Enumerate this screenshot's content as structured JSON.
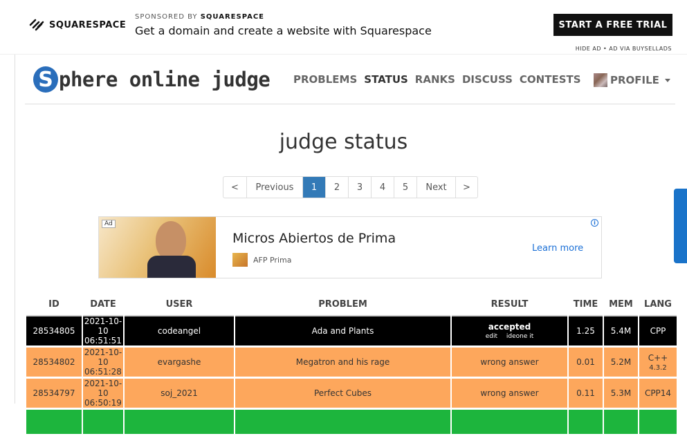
{
  "ad_top": {
    "brand": "SQUARESPACE",
    "sponsored_prefix": "SPONSORED BY",
    "sponsored_brand": "SQUARESPACE",
    "headline": "Get a domain and create a website with Squarespace",
    "cta": "START A FREE TRIAL",
    "footer": "HIDE AD • AD VIA BUYSELLADS"
  },
  "brand": {
    "letter": "S",
    "text": "phere online judge",
    "color": "#2a6ebb"
  },
  "nav": {
    "items": [
      "PROBLEMS",
      "STATUS",
      "RANKS",
      "DISCUSS",
      "CONTESTS"
    ],
    "active": "STATUS",
    "profile": "PROFILE"
  },
  "page_title": "judge status",
  "pagination": {
    "first": "<",
    "previous": "Previous",
    "pages": [
      "1",
      "2",
      "3",
      "4",
      "5"
    ],
    "current": "1",
    "next": "Next",
    "last": ">"
  },
  "ad_inner": {
    "tag": "Ad",
    "title": "Micros Abiertos de Prima",
    "advertiser": "AFP Prima",
    "learn_more": "Learn more",
    "info": "i"
  },
  "table": {
    "headers": [
      "ID",
      "DATE",
      "USER",
      "PROBLEM",
      "RESULT",
      "TIME",
      "MEM",
      "LANG"
    ],
    "rows": [
      {
        "id": "28534805",
        "date": "2021-10-10",
        "time_of_day": "06:51:51",
        "user": "codeangel",
        "problem": "Ada and Plants",
        "result": "accepted",
        "links": [
          "edit",
          "ideone it"
        ],
        "time": "1.25",
        "mem": "5.4M",
        "lang": "CPP",
        "lang_ver": "",
        "status": "accepted"
      },
      {
        "id": "28534802",
        "date": "2021-10-10",
        "time_of_day": "06:51:28",
        "user": "evargashe",
        "problem": "Megatron and his rage",
        "result": "wrong answer",
        "links": [],
        "time": "0.01",
        "mem": "5.2M",
        "lang": "C++",
        "lang_ver": "4.3.2",
        "status": "wrong"
      },
      {
        "id": "28534797",
        "date": "2021-10-10",
        "time_of_day": "06:50:19",
        "user": "soj_2021",
        "problem": "Perfect Cubes",
        "result": "wrong answer",
        "links": [],
        "time": "0.11",
        "mem": "5.3M",
        "lang": "CPP14",
        "lang_ver": "",
        "status": "wrong"
      }
    ]
  },
  "colors": {
    "accepted_bg": "#000000",
    "wrong_bg": "#fda75c",
    "next_row_bg": "#1db53d",
    "pagination_active": "#337ab7"
  }
}
